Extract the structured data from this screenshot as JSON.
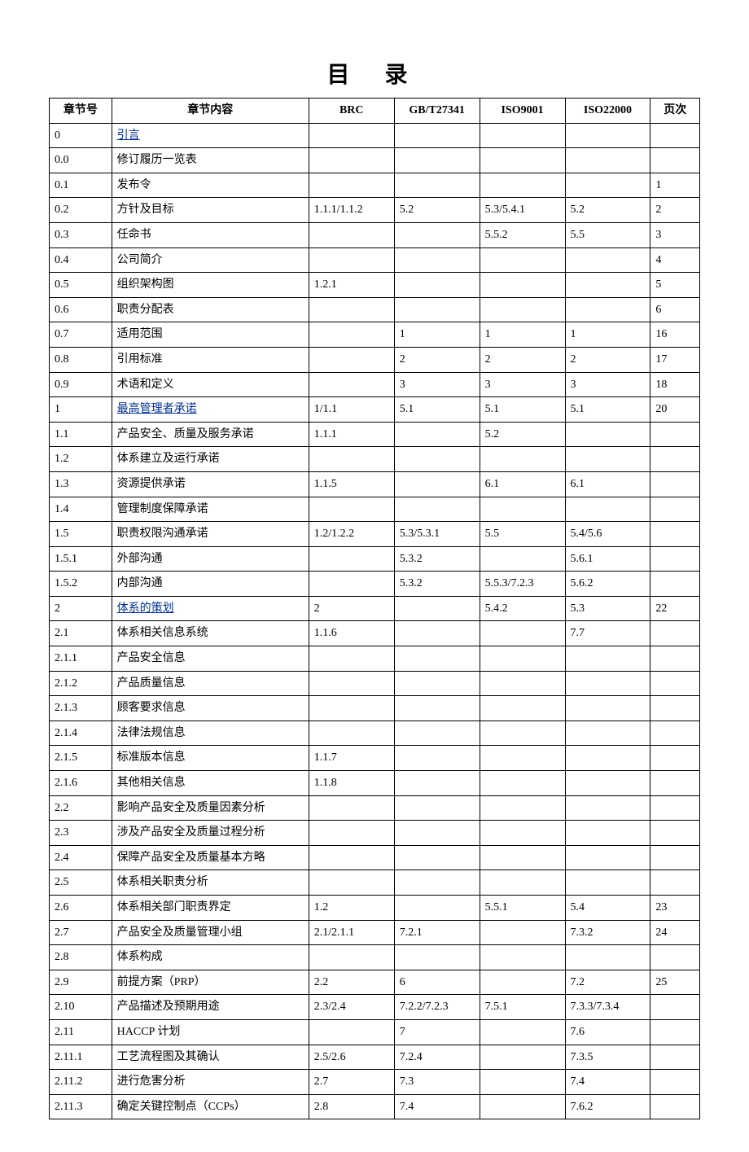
{
  "title": "目 录",
  "headers": {
    "section": "章节号",
    "content": "章节内容",
    "brc": "BRC",
    "gbt": "GB/T27341",
    "iso9001": "ISO9001",
    "iso22000": "ISO22000",
    "page": "页次"
  },
  "rows": [
    {
      "sec": "0",
      "content": "引言",
      "link": true,
      "brc": "",
      "gbt": "",
      "iso9": "",
      "iso22": "",
      "page": ""
    },
    {
      "sec": "0.0",
      "content": "修订履历一览表",
      "brc": "",
      "gbt": "",
      "iso9": "",
      "iso22": "",
      "page": ""
    },
    {
      "sec": "0.1",
      "content": "发布令",
      "brc": "",
      "gbt": "",
      "iso9": "",
      "iso22": "",
      "page": "1"
    },
    {
      "sec": "0.2",
      "content": "方针及目标",
      "brc": "1.1.1/1.1.2",
      "gbt": "5.2",
      "iso9": "5.3/5.4.1",
      "iso22": "5.2",
      "page": "2"
    },
    {
      "sec": "0.3",
      "content": "任命书",
      "brc": "",
      "gbt": "",
      "iso9": "5.5.2",
      "iso22": "5.5",
      "page": "3"
    },
    {
      "sec": "0.4",
      "content": "公司简介",
      "brc": "",
      "gbt": "",
      "iso9": "",
      "iso22": "",
      "page": "4"
    },
    {
      "sec": "0.5",
      "content": "组织架构图",
      "brc": "1.2.1",
      "gbt": "",
      "iso9": "",
      "iso22": "",
      "page": "5"
    },
    {
      "sec": "0.6",
      "content": "职责分配表",
      "brc": "",
      "gbt": "",
      "iso9": "",
      "iso22": "",
      "page": "6"
    },
    {
      "sec": "0.7",
      "content": "适用范围",
      "brc": "",
      "gbt": "1",
      "iso9": "1",
      "iso22": "1",
      "page": "16"
    },
    {
      "sec": "0.8",
      "content": "引用标准",
      "brc": "",
      "gbt": "2",
      "iso9": "2",
      "iso22": "2",
      "page": "17"
    },
    {
      "sec": "0.9",
      "content": "术语和定义",
      "brc": "",
      "gbt": "3",
      "iso9": "3",
      "iso22": "3",
      "page": "18"
    },
    {
      "sec": "1",
      "content": "最高管理者承诺",
      "link": true,
      "brc": "1/1.1",
      "gbt": "5.1",
      "iso9": "5.1",
      "iso22": "5.1",
      "page": "20"
    },
    {
      "sec": "1.1",
      "content": "产品安全、质量及服务承诺",
      "brc": "1.1.1",
      "gbt": "",
      "iso9": "5.2",
      "iso22": "",
      "page": ""
    },
    {
      "sec": "1.2",
      "content": "体系建立及运行承诺",
      "brc": "",
      "gbt": "",
      "iso9": "",
      "iso22": "",
      "page": ""
    },
    {
      "sec": "1.3",
      "content": "资源提供承诺",
      "brc": "1.1.5",
      "gbt": "",
      "iso9": "6.1",
      "iso22": "6.1",
      "page": ""
    },
    {
      "sec": "1.4",
      "content": "管理制度保障承诺",
      "brc": "",
      "gbt": "",
      "iso9": "",
      "iso22": "",
      "page": ""
    },
    {
      "sec": "1.5",
      "content": "职责权限沟通承诺",
      "brc": "1.2/1.2.2",
      "gbt": "5.3/5.3.1",
      "iso9": "5.5",
      "iso22": "5.4/5.6",
      "page": ""
    },
    {
      "sec": "1.5.1",
      "content": "外部沟通",
      "brc": "",
      "gbt": "5.3.2",
      "iso9": "",
      "iso22": "5.6.1",
      "page": ""
    },
    {
      "sec": "1.5.2",
      "content": "内部沟通",
      "brc": "",
      "gbt": "5.3.2",
      "iso9": "5.5.3/7.2.3",
      "iso22": "5.6.2",
      "page": ""
    },
    {
      "sec": "2",
      "content": "体系的策划",
      "link": true,
      "brc": "2",
      "gbt": "",
      "iso9": "5.4.2",
      "iso22": "5.3",
      "page": "22"
    },
    {
      "sec": "2.1",
      "content": "体系相关信息系统",
      "brc": "1.1.6",
      "gbt": "",
      "iso9": "",
      "iso22": "7.7",
      "page": ""
    },
    {
      "sec": "2.1.1",
      "content": "产品安全信息",
      "brc": "",
      "gbt": "",
      "iso9": "",
      "iso22": "",
      "page": ""
    },
    {
      "sec": "2.1.2",
      "content": "产品质量信息",
      "brc": "",
      "gbt": "",
      "iso9": "",
      "iso22": "",
      "page": ""
    },
    {
      "sec": "2.1.3",
      "content": "顾客要求信息",
      "brc": "",
      "gbt": "",
      "iso9": "",
      "iso22": "",
      "page": ""
    },
    {
      "sec": "2.1.4",
      "content": "法律法规信息",
      "brc": "",
      "gbt": "",
      "iso9": "",
      "iso22": "",
      "page": ""
    },
    {
      "sec": "2.1.5",
      "content": "标准版本信息",
      "brc": "1.1.7",
      "gbt": "",
      "iso9": "",
      "iso22": "",
      "page": ""
    },
    {
      "sec": "2.1.6",
      "content": "其他相关信息",
      "brc": "1.1.8",
      "gbt": "",
      "iso9": "",
      "iso22": "",
      "page": ""
    },
    {
      "sec": "2.2",
      "content": "影响产品安全及质量因素分析",
      "brc": "",
      "gbt": "",
      "iso9": "",
      "iso22": "",
      "page": ""
    },
    {
      "sec": "2.3",
      "content": "涉及产品安全及质量过程分析",
      "brc": "",
      "gbt": "",
      "iso9": "",
      "iso22": "",
      "page": ""
    },
    {
      "sec": "2.4",
      "content": "保障产品安全及质量基本方略",
      "brc": "",
      "gbt": "",
      "iso9": "",
      "iso22": "",
      "page": ""
    },
    {
      "sec": "2.5",
      "content": "体系相关职责分析",
      "brc": "",
      "gbt": "",
      "iso9": "",
      "iso22": "",
      "page": ""
    },
    {
      "sec": "2.6",
      "content": "体系相关部门职责界定",
      "brc": "1.2",
      "gbt": "",
      "iso9": "5.5.1",
      "iso22": "5.4",
      "page": "23"
    },
    {
      "sec": "2.7",
      "content": "产品安全及质量管理小组",
      "brc": "2.1/2.1.1",
      "gbt": "7.2.1",
      "iso9": "",
      "iso22": "7.3.2",
      "page": "24"
    },
    {
      "sec": "2.8",
      "content": "体系构成",
      "brc": "",
      "gbt": "",
      "iso9": "",
      "iso22": "",
      "page": ""
    },
    {
      "sec": "2.9",
      "content": "前提方案（PRP）",
      "brc": "2.2",
      "gbt": "6",
      "iso9": "",
      "iso22": "7.2",
      "page": "25"
    },
    {
      "sec": "2.10",
      "content": "产品描述及预期用途",
      "brc": "2.3/2.4",
      "gbt": "7.2.2/7.2.3",
      "iso9": "7.5.1",
      "iso22": "7.3.3/7.3.4",
      "page": ""
    },
    {
      "sec": "2.11",
      "content": "HACCP 计划",
      "brc": "",
      "gbt": "7",
      "iso9": "",
      "iso22": "7.6",
      "page": ""
    },
    {
      "sec": "2.11.1",
      "content": "工艺流程图及其确认",
      "brc": "2.5/2.6",
      "gbt": "7.2.4",
      "iso9": "",
      "iso22": "7.3.5",
      "page": ""
    },
    {
      "sec": "2.11.2",
      "content": "进行危害分析",
      "brc": "2.7",
      "gbt": "7.3",
      "iso9": "",
      "iso22": "7.4",
      "page": ""
    },
    {
      "sec": "2.11.3",
      "content": "确定关键控制点（CCPs）",
      "brc": "2.8",
      "gbt": "7.4",
      "iso9": "",
      "iso22": "7.6.2",
      "page": ""
    }
  ]
}
